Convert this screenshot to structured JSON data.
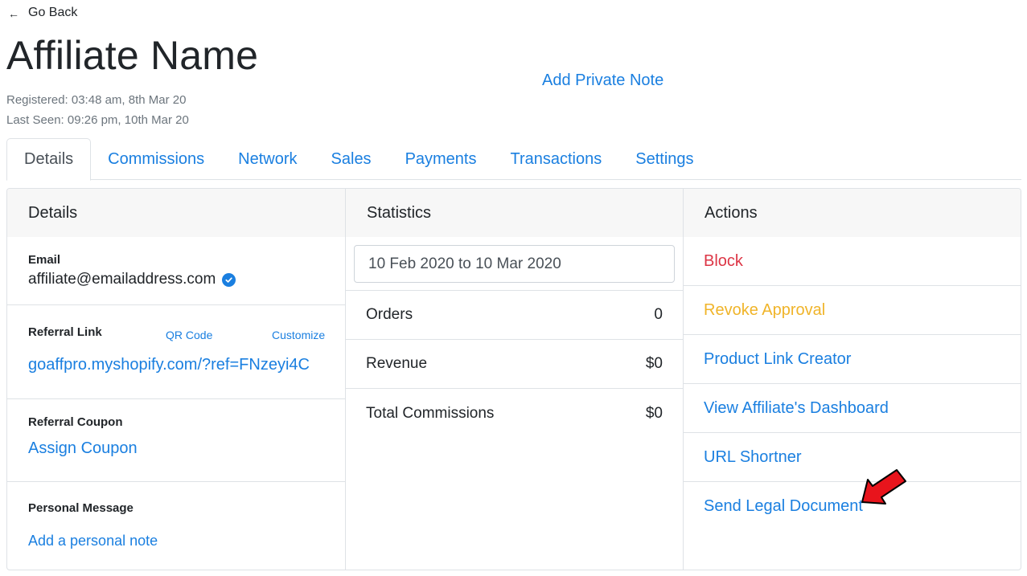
{
  "nav": {
    "back_label": "Go Back"
  },
  "header": {
    "title": "Affiliate Name",
    "add_note_label": "Add Private Note",
    "registered": "Registered: 03:48 am, 8th Mar 20",
    "last_seen": "Last Seen: 09:26 pm, 10th Mar 20"
  },
  "tabs": [
    {
      "label": "Details",
      "active": true
    },
    {
      "label": "Commissions"
    },
    {
      "label": "Network"
    },
    {
      "label": "Sales"
    },
    {
      "label": "Payments"
    },
    {
      "label": "Transactions"
    },
    {
      "label": "Settings"
    }
  ],
  "details": {
    "header": "Details",
    "email_label": "Email",
    "email_value": "affiliate@emailaddress.com",
    "referral_link_label": "Referral Link",
    "qr_code_label": "QR Code",
    "customize_label": "Customize",
    "referral_link": "goaffpro.myshopify.com/?ref=FNzeyi4C",
    "coupon_label": "Referral Coupon",
    "assign_coupon": "Assign Coupon",
    "message_label": "Personal Message",
    "add_note": "Add a personal note"
  },
  "statistics": {
    "header": "Statistics",
    "date_range": "10 Feb 2020 to 10 Mar 2020",
    "rows": [
      {
        "label": "Orders",
        "value": "0"
      },
      {
        "label": "Revenue",
        "value": "$0"
      },
      {
        "label": "Total Commissions",
        "value": "$0"
      }
    ]
  },
  "actions": {
    "header": "Actions",
    "items": [
      {
        "label": "Block"
      },
      {
        "label": "Revoke Approval"
      },
      {
        "label": "Product Link Creator"
      },
      {
        "label": "View Affiliate's Dashboard"
      },
      {
        "label": "URL Shortner"
      },
      {
        "label": "Send Legal Document"
      }
    ]
  },
  "icons": {
    "back": "arrow-left-icon",
    "verified": "check-circle-icon",
    "annotation": "red-arrow-icon"
  },
  "colors": {
    "link": "#1a7fe0",
    "danger": "#dc3545",
    "warning": "#f0b429",
    "annotation_arrow": "#e8141c"
  }
}
